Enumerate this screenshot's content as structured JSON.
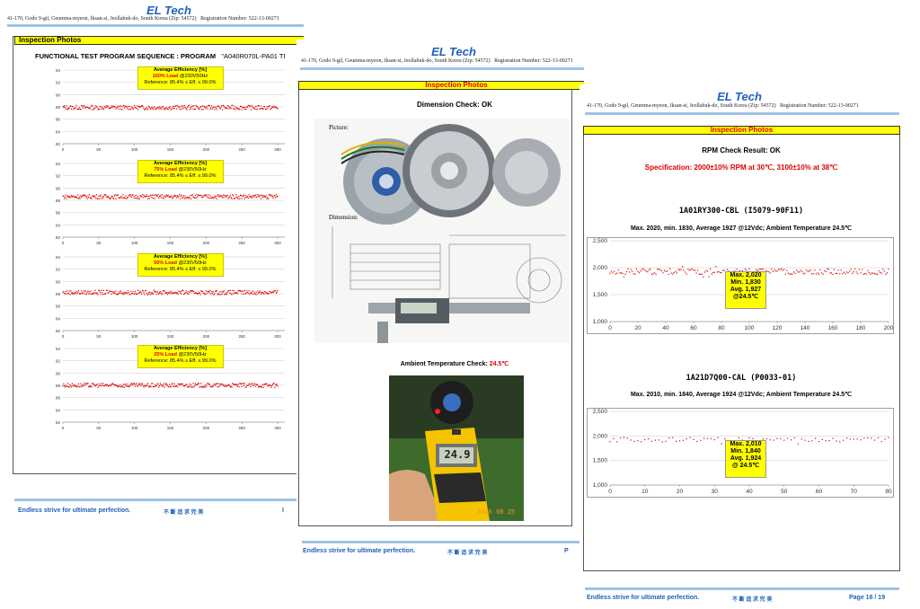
{
  "header": {
    "company": "EL Tech",
    "address": "41-170, Godo 9-gil, Geumma-myeon, Iksan-si, Jeollabuk-do, South Korea (Zip: 54572)",
    "registration": "Registration Number: 522-13-00271"
  },
  "footer": {
    "slogan": "Endless strive for ultimate perfection.",
    "chinese": "不 斷 追 求 完 美",
    "page_partial_1": "I",
    "page_partial_2": "P",
    "page_number": "Page 16 / 19"
  },
  "page1": {
    "section": "Inspection Photos",
    "heading": "FUNCTIONAL TEST PROGRAM SEQUENCE : PROGRAM",
    "program_code": "\"A040R070L-PA01 TI"
  },
  "page2": {
    "section": "Inspection Photos",
    "dimension_title": "Dimension Check: OK",
    "picture_label": "Picture:",
    "dimension_label": "Dimension:",
    "ambient_label": "Ambient Temperature Check:",
    "ambient_value": "24.5℃",
    "thermo_reading": "24.9",
    "date_stamp": "2016 08 25"
  },
  "page3": {
    "section": "Inspection Photos",
    "rpm_title": "RPM Check Result: OK",
    "spec": "Specification: 2000±10% RPM at 30℃, 3100±10% at 38℃",
    "fan1_name": "1A01RY300-CBL (I5079-90F11)",
    "fan1_desc": "Max. 2020, min. 1830, Average 1927 @12Vdc; Ambient Temperature 24.5℃",
    "fan1_box": {
      "max": "Max. 2,020",
      "min": "Min. 1,830",
      "avg": "Avg. 1,927",
      "temp": "@24.5℃"
    },
    "fan2_name": "1A21D7Q00-CAL (P0033-01)",
    "fan2_desc": "Max. 2010, min. 1840, Average 1924 @12Vdc; Ambient Temperature 24.5℃",
    "fan2_box": {
      "max": "Max. 2,010",
      "min": "Min. 1,840",
      "avg": "Avg. 1,924",
      "temp": "@ 24.5℃"
    }
  },
  "chart_data": [
    {
      "type": "scatter",
      "label": "Average Efficiency [%]",
      "load": "100% Load",
      "cond": "@230V50Hz",
      "reference": "Reference: 85.4% ≤ Eff. ≤ 99.0%",
      "x_ticks": [
        "0",
        "50",
        "100",
        "150",
        "200",
        "250",
        "300"
      ],
      "y_ticks": [
        "94",
        "92",
        "90",
        "88",
        "86",
        "84",
        "82"
      ],
      "xlim": [
        0,
        310
      ],
      "ylim": [
        82,
        94
      ],
      "mean": 87.9
    },
    {
      "type": "scatter",
      "label": "Average Efficiency [%]",
      "load": "75% Load",
      "cond": "@230V50Hz",
      "reference": "Reference: 85.4% ≤ Eff. ≤ 99.0%",
      "x_ticks": [
        "0",
        "50",
        "100",
        "150",
        "200",
        "250",
        "300"
      ],
      "y_ticks": [
        "94",
        "92",
        "90",
        "88",
        "86",
        "84",
        "82"
      ],
      "xlim": [
        0,
        310
      ],
      "ylim": [
        82,
        94
      ],
      "mean": 88.6
    },
    {
      "type": "scatter",
      "label": "Average Efficiency [%]",
      "load": "50% Load",
      "cond": "@230V50Hz",
      "reference": "Reference: 85.4% ≤ Eff. ≤ 99.0%",
      "x_ticks": [
        "0",
        "50",
        "100",
        "150",
        "200",
        "250",
        "300"
      ],
      "y_ticks": [
        "94",
        "92",
        "90",
        "88",
        "86",
        "84",
        "82"
      ],
      "xlim": [
        0,
        310
      ],
      "ylim": [
        82,
        94
      ],
      "mean": 88.2
    },
    {
      "type": "scatter",
      "label": "Average Efficiency [%]",
      "load": "25% Load",
      "cond": "@230V50Hz",
      "reference": "Reference: 85.4% ≤ Eff. ≤ 99.0%",
      "x_ticks": [
        "0",
        "50",
        "100",
        "150",
        "200",
        "250",
        "300"
      ],
      "y_ticks": [
        "94",
        "92",
        "90",
        "88",
        "86",
        "84",
        "82"
      ],
      "xlim": [
        0,
        310
      ],
      "ylim": [
        82,
        94
      ],
      "mean": 88.0
    },
    {
      "type": "scatter",
      "x_ticks": [
        "0",
        "20",
        "40",
        "60",
        "80",
        "100",
        "120",
        "140",
        "160",
        "180",
        "200"
      ],
      "y_ticks": [
        "2,500",
        "2,000",
        "1,500",
        "1,000"
      ],
      "xlim": [
        0,
        200
      ],
      "ylim": [
        1000,
        2500
      ],
      "mean": 1927,
      "max": 2020,
      "min": 1830
    },
    {
      "type": "scatter",
      "x_ticks": [
        "0",
        "10",
        "20",
        "30",
        "40",
        "50",
        "60",
        "70",
        "80"
      ],
      "y_ticks": [
        "2,500",
        "2,000",
        "1,500",
        "1,000"
      ],
      "xlim": [
        0,
        80
      ],
      "ylim": [
        1000,
        2500
      ],
      "mean": 1924,
      "max": 2010,
      "min": 1840
    }
  ],
  "colors": {
    "accent_blue": "#1f5fbf",
    "section_yellow": "#ffff00",
    "marker_red": "#dd0000"
  }
}
